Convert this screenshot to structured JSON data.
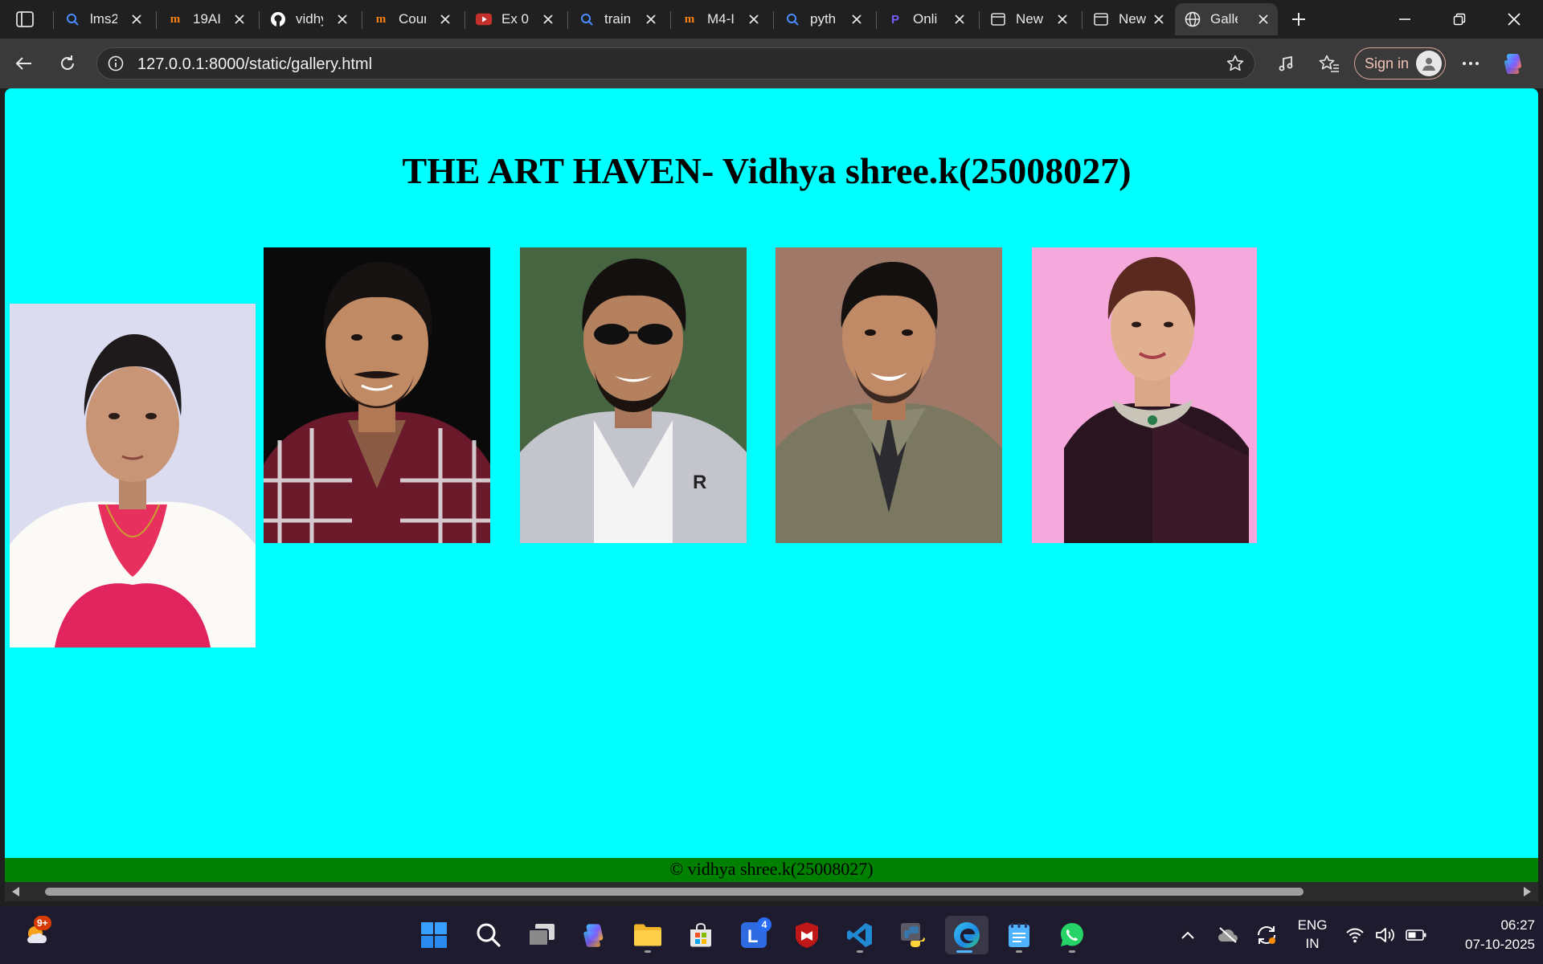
{
  "browser": {
    "tabs": [
      {
        "title": "lms2",
        "icon": "search-icon"
      },
      {
        "title": "19AI",
        "icon": "moodle-icon"
      },
      {
        "title": "vidhya",
        "icon": "github-icon"
      },
      {
        "title": "Cour",
        "icon": "moodle-icon"
      },
      {
        "title": "Ex 0",
        "icon": "youtube-icon"
      },
      {
        "title": "train",
        "icon": "search-icon"
      },
      {
        "title": "M4-I",
        "icon": "moodle-icon"
      },
      {
        "title": "pyth",
        "icon": "search-icon"
      },
      {
        "title": "Onli",
        "icon": "p-logo-icon"
      },
      {
        "title": "New",
        "icon": "new-tab-page-icon"
      },
      {
        "title": "New",
        "icon": "new-tab-page-icon"
      },
      {
        "title": "Galle",
        "icon": "globe-icon",
        "active": true
      }
    ],
    "address": "127.0.0.1:8000/static/gallery.html",
    "sign_in_label": "Sign in"
  },
  "page": {
    "heading": "THE ART HAVEN- Vidhya shree.k(25008027)",
    "gallery": [
      {
        "name": "photo-woman-white-dupatta",
        "bg": "#dcdcf0"
      },
      {
        "name": "photo-man-checked-shirt",
        "bg": "#0a0a0a"
      },
      {
        "name": "photo-man-sunglasses",
        "bg": "#3c5a3a"
      },
      {
        "name": "photo-man-khaki-shirt",
        "bg": "#a07868"
      },
      {
        "name": "photo-woman-black-saree",
        "bg": "#f4a8dc"
      }
    ],
    "footer": "© vidhya shree.k(25008027)"
  },
  "taskbar": {
    "weather_badge": "9+",
    "lens_badge": "4",
    "language": [
      "ENG",
      "IN"
    ],
    "time": "06:27",
    "date": "07-10-2025"
  }
}
